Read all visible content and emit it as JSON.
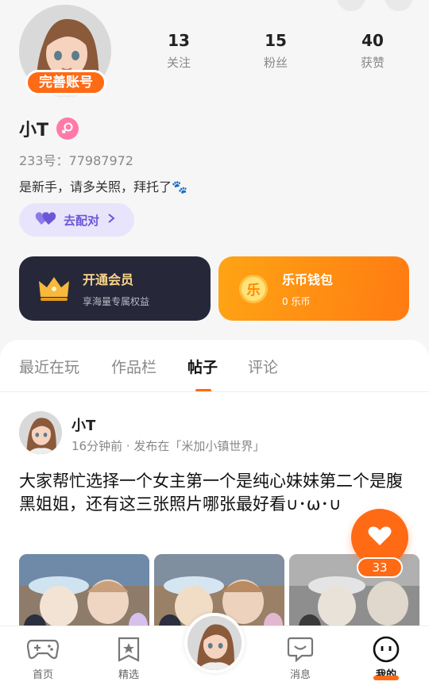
{
  "profile": {
    "badge_label": "完善账号",
    "name": "小T",
    "uid": "233号：77987972",
    "bio": "是新手，请多关照，拜托了🐾",
    "pair_label": "去配对",
    "stats": [
      {
        "num": "13",
        "label": "关注"
      },
      {
        "num": "15",
        "label": "粉丝"
      },
      {
        "num": "40",
        "label": "获赞"
      }
    ]
  },
  "cards": {
    "vip": {
      "title": "开通会员",
      "sub": "享海量专属权益"
    },
    "wallet": {
      "title": "乐币钱包",
      "sub": "0 乐币",
      "icon_text": "乐"
    }
  },
  "tabs": [
    {
      "label": "最近在玩",
      "active": false
    },
    {
      "label": "作品栏",
      "active": false
    },
    {
      "label": "帖子",
      "active": true
    },
    {
      "label": "评论",
      "active": false
    }
  ],
  "post": {
    "author": "小T",
    "meta": "16分钟前 · 发布在「米加小镇世界」",
    "text": "大家帮忙选择一个女主第一个是纯心妹妹第二个是腹黑姐姐，还有这三张照片哪张最好看∪･ω･∪",
    "like_count": "33"
  },
  "nav": [
    {
      "label": "首页",
      "icon": "gamepad-icon"
    },
    {
      "label": "精选",
      "icon": "star-bookmark-icon"
    },
    {
      "label": "消息",
      "icon": "chat-icon"
    },
    {
      "label": "我的",
      "icon": "face-icon",
      "active": true
    }
  ],
  "colors": {
    "accent": "#ff6a14",
    "vip_bg": "#26283a",
    "vip_gold": "#fbd58b",
    "pair_bg": "#e8e4fb",
    "pair_text": "#6b56d9"
  }
}
